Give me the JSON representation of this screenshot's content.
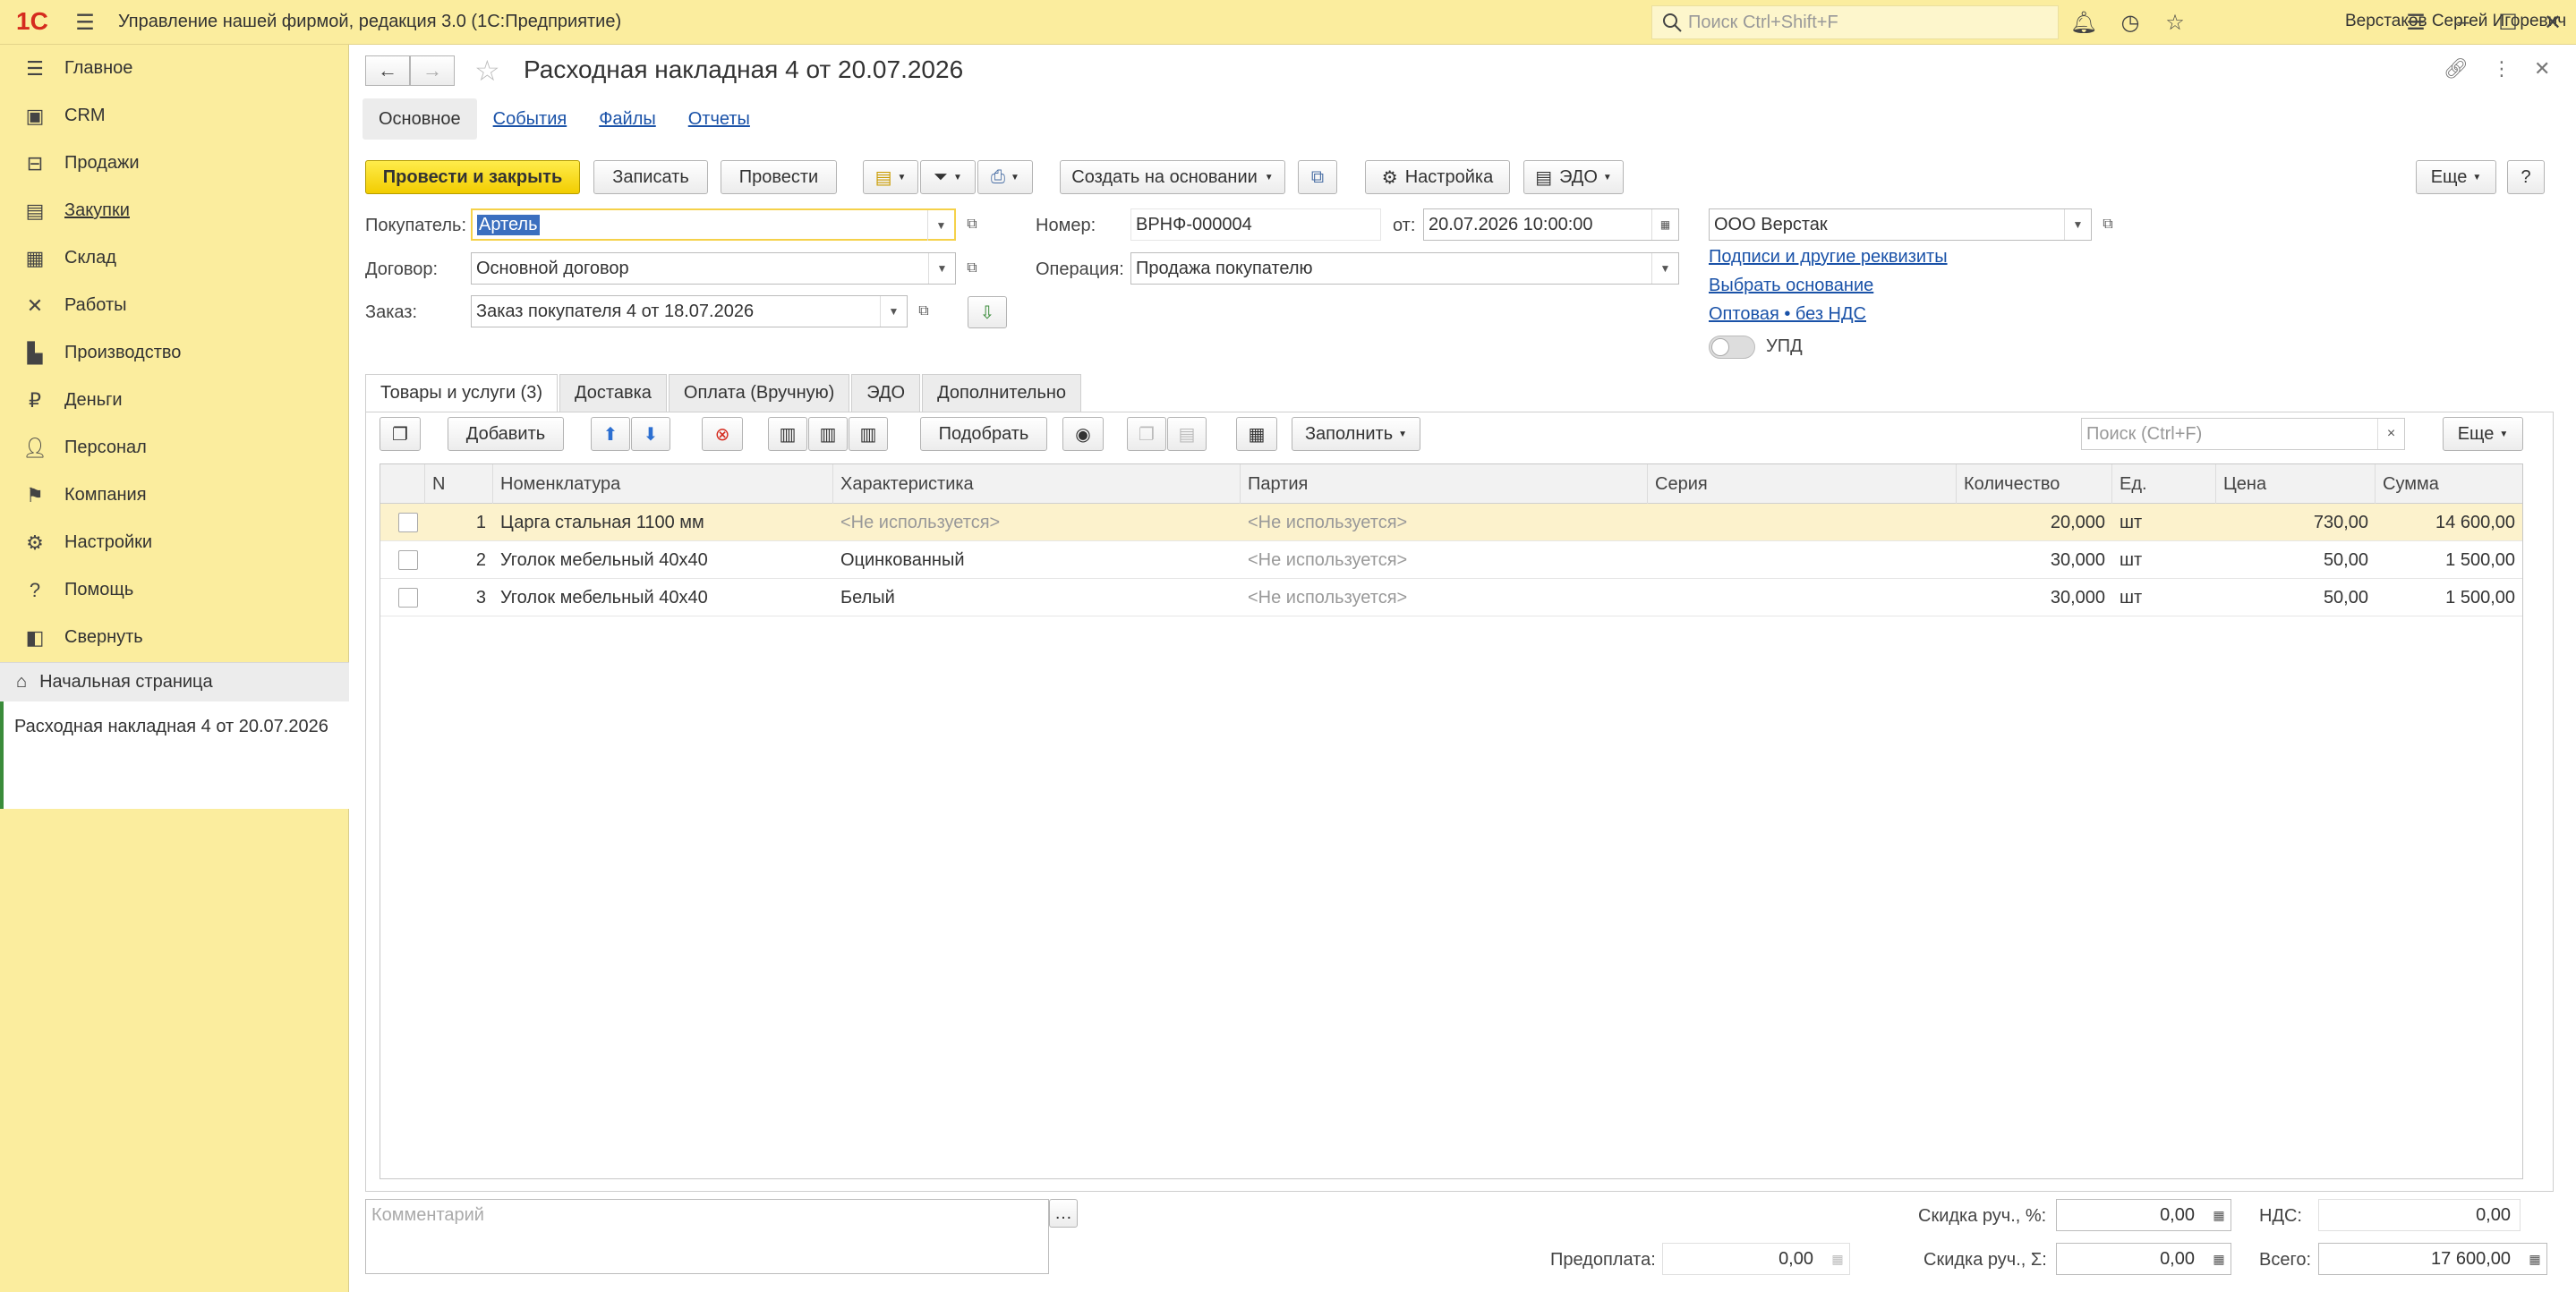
{
  "app": {
    "title": "Управление нашей фирмой, редакция 3.0  (1С:Предприятие)",
    "logo": "1С",
    "search_placeholder": "Поиск Ctrl+Shift+F",
    "user": "Верстаков Сергей Игоревич"
  },
  "sidebar": {
    "items": [
      {
        "label": "Главное",
        "icon": "menu-lines-icon"
      },
      {
        "label": "CRM",
        "icon": "crm-icon"
      },
      {
        "label": "Продажи",
        "icon": "basket-icon"
      },
      {
        "label": "Закупки",
        "icon": "purchases-icon"
      },
      {
        "label": "Склад",
        "icon": "warehouse-icon"
      },
      {
        "label": "Работы",
        "icon": "tools-icon"
      },
      {
        "label": "Производство",
        "icon": "factory-icon"
      },
      {
        "label": "Деньги",
        "icon": "ruble-icon"
      },
      {
        "label": "Персонал",
        "icon": "people-icon"
      },
      {
        "label": "Компания",
        "icon": "flag-icon"
      },
      {
        "label": "Настройки",
        "icon": "gear-icon"
      },
      {
        "label": "Помощь",
        "icon": "help-icon"
      },
      {
        "label": "Свернуть",
        "icon": "collapse-icon"
      }
    ],
    "home": "Начальная страница",
    "open_doc": "Расходная накладная 4 от 20.07.2026"
  },
  "doc": {
    "title": "Расходная накладная 4 от 20.07.2026",
    "tabs": [
      "Основное",
      "События",
      "Файлы",
      "Отчеты"
    ],
    "toolbar": {
      "post_close": "Провести и закрыть",
      "save": "Записать",
      "post": "Провести",
      "create_based": "Создать на основании",
      "settings": "Настройка",
      "edo": "ЭДО",
      "more": "Еще",
      "help": "?"
    },
    "fields": {
      "buyer_label": "Покупатель:",
      "buyer": "Артель",
      "contract_label": "Договор:",
      "contract": "Основной договор",
      "order_label": "Заказ:",
      "order": "Заказ покупателя 4 от 18.07.2026",
      "number_label": "Номер:",
      "number": "ВРНФ-000004",
      "date_label": "от:",
      "date": "20.07.2026 10:00:00",
      "operation_label": "Операция:",
      "operation": "Продажа покупателю",
      "company": "ООО Верстак"
    },
    "links": {
      "signatures": "Подписи и другие реквизиты",
      "choose_basis": "Выбрать основание",
      "price_type": "Оптовая • без НДС"
    },
    "upd_label": "УПД",
    "upd_on": false
  },
  "table": {
    "tabs": [
      "Товары и услуги (3)",
      "Доставка",
      "Оплата (Вручную)",
      "ЭДО",
      "Дополнительно"
    ],
    "add": "Добавить",
    "pick": "Подобрать",
    "fill": "Заполнить",
    "search_placeholder": "Поиск (Ctrl+F)",
    "more": "Еще",
    "columns": [
      "N",
      "Номенклатура",
      "Характеристика",
      "Партия",
      "Серия",
      "Количество",
      "Ед.",
      "Цена",
      "Сумма"
    ],
    "rows": [
      {
        "n": "1",
        "item": "Царга стальная 1100 мм",
        "char": "<Не используется>",
        "batch": "<Не используется>",
        "series": "",
        "qty": "20,000",
        "unit": "шт",
        "price": "730,00",
        "sum": "14 600,00"
      },
      {
        "n": "2",
        "item": "Уголок мебельный 40х40",
        "char": "Оцинкованный",
        "batch": "<Не используется>",
        "series": "",
        "qty": "30,000",
        "unit": "шт",
        "price": "50,00",
        "sum": "1 500,00"
      },
      {
        "n": "3",
        "item": "Уголок мебельный 40х40",
        "char": "Белый",
        "batch": "<Не используется>",
        "series": "",
        "qty": "30,000",
        "unit": "шт",
        "price": "50,00",
        "sum": "1 500,00"
      }
    ]
  },
  "footer": {
    "comment_placeholder": "Комментарий",
    "discount_pct_label": "Скидка руч., %:",
    "discount_pct": "0,00",
    "vat_label": "НДС:",
    "vat": "0,00",
    "prepay_label": "Предоплата:",
    "prepay": "0,00",
    "discount_sum_label": "Скидка руч., Σ:",
    "discount_sum": "0,00",
    "total_label": "Всего:",
    "total": "17 600,00"
  }
}
